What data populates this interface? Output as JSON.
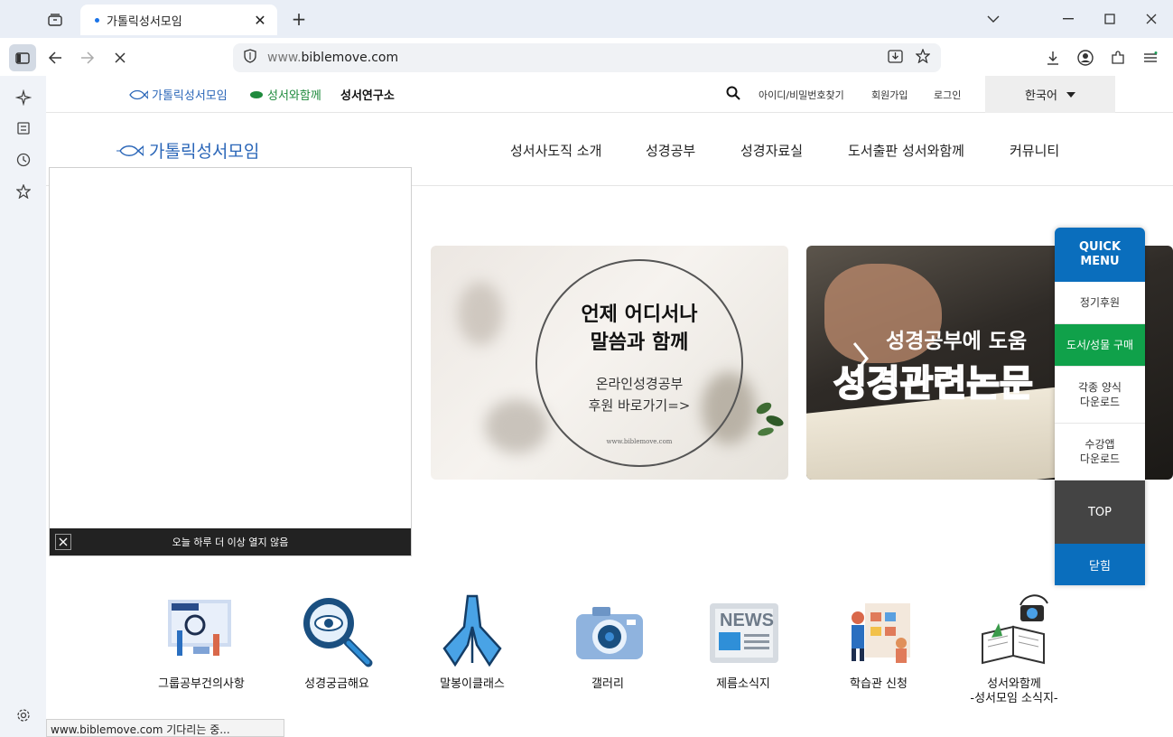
{
  "browser": {
    "tab_title": "가톨릭성서모임",
    "url_prefix": "www.",
    "url_host": "biblemove.com"
  },
  "util": {
    "logo1": "가톨릭성서모임",
    "logo2": "성서와함께",
    "logo3": "성서연구소",
    "find_id": "아이디/비밀번호찾기",
    "signup": "회원가입",
    "login": "로그인",
    "language": "한국어"
  },
  "gnb": {
    "logo": "가톨릭성서모임",
    "items": [
      "성서사도직 소개",
      "성경공부",
      "성경자료실",
      "도서출판 성서와함께",
      "커뮤니티"
    ]
  },
  "banners": {
    "b1_line1": "언제 어디서나",
    "b1_line2": "말씀과 함께",
    "b1_sub1": "온라인성경공부",
    "b1_sub2": "후원 바로가기=>",
    "b1_url": "www.biblemove.com",
    "b2_title": "성경공부에 도움",
    "b2_outline": "성경관련논문"
  },
  "popup": {
    "dismiss": "오늘 하루 더 이상 열지 않음"
  },
  "quick": {
    "head1": "QUICK",
    "head2": "MENU",
    "items": [
      "정기후원",
      "도서/성물 구매",
      "각종 양식",
      "다운로드",
      "수강앱",
      "다운로드"
    ],
    "top": "TOP",
    "close": "닫힘"
  },
  "quicklinks": [
    {
      "label": "그룹공부건의사항"
    },
    {
      "label": "성경궁금해요"
    },
    {
      "label": "말봉이클래스"
    },
    {
      "label": "갤러리"
    },
    {
      "label": "제름소식지"
    },
    {
      "label": "학습관 신청"
    },
    {
      "label": "성서와함께",
      "label2": "-성서모임 소식지-"
    }
  ],
  "status": "www.biblemove.com 기다리는 중...",
  "colors": {
    "brand_blue": "#0a6ebd",
    "brand_green": "#10a14a"
  }
}
